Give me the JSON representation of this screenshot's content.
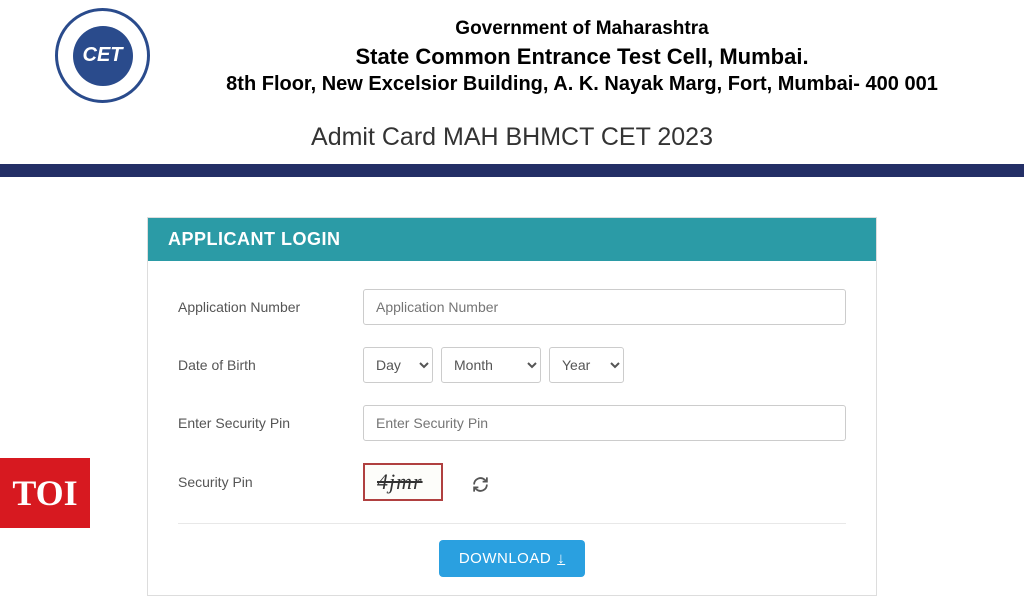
{
  "header": {
    "logo_abbr": "CET",
    "gov_line": "Government of Maharashtra",
    "cell_line": "State Common Entrance Test Cell, Mumbai.",
    "addr_line": "8th Floor, New Excelsior Building, A. K. Nayak Marg, Fort, Mumbai- 400 001"
  },
  "page_title": "Admit Card MAH BHMCT CET 2023",
  "login": {
    "panel_title": "APPLICANT LOGIN",
    "fields": {
      "app_no_label": "Application Number",
      "app_no_placeholder": "Application Number",
      "dob_label": "Date of Birth",
      "day_option": "Day",
      "month_option": "Month",
      "year_option": "Year",
      "sec_pin_input_label": "Enter Security Pin",
      "sec_pin_placeholder": "Enter Security Pin",
      "sec_pin_display_label": "Security Pin",
      "captcha_value": "4jmr"
    },
    "download_label": "DOWNLOAD"
  },
  "watermark": "TOI"
}
